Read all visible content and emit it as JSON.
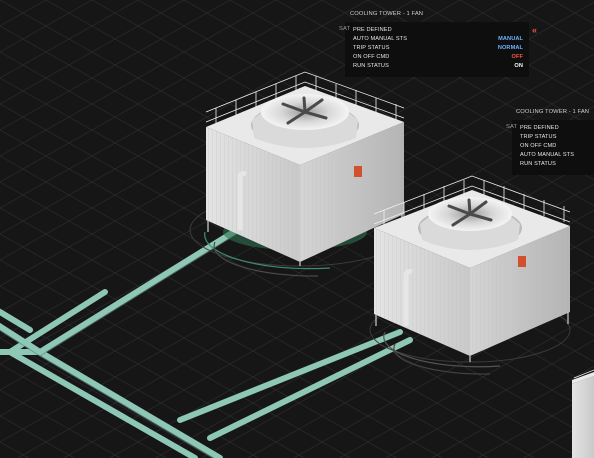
{
  "colors": {
    "background": "#161616",
    "grid": "#2a2a2a",
    "pipe": "#8fc7b6",
    "manual": "#6fb4ff",
    "normal": "#6fb4ff",
    "off": "#ff5a3c",
    "on": "#ffffff",
    "accent": "#e05a3a"
  },
  "tower1": {
    "title": "COOLING TOWER - 1 FAN",
    "sat": "SAT",
    "chevron": "«",
    "rows": [
      {
        "label": "PRE DEFINED",
        "value": ""
      },
      {
        "label": "AUTO MANUAL STS",
        "value": "MANUAL"
      },
      {
        "label": "TRIP STATUS",
        "value": "NORMAL"
      },
      {
        "label": "ON OFF CMD",
        "value": "OFF"
      },
      {
        "label": "RUN STATUS",
        "value": "ON"
      }
    ]
  },
  "tower2": {
    "title": "COOLING TOWER - 1 FAN",
    "sat": "SAT",
    "rows": [
      {
        "label": "PRE DEFINED",
        "value": ""
      },
      {
        "label": "TRIP STATUS",
        "value": ""
      },
      {
        "label": "ON OFF CMD",
        "value": ""
      },
      {
        "label": "AUTO MANUAL STS",
        "value": ""
      },
      {
        "label": "RUN STATUS",
        "value": ""
      }
    ]
  }
}
